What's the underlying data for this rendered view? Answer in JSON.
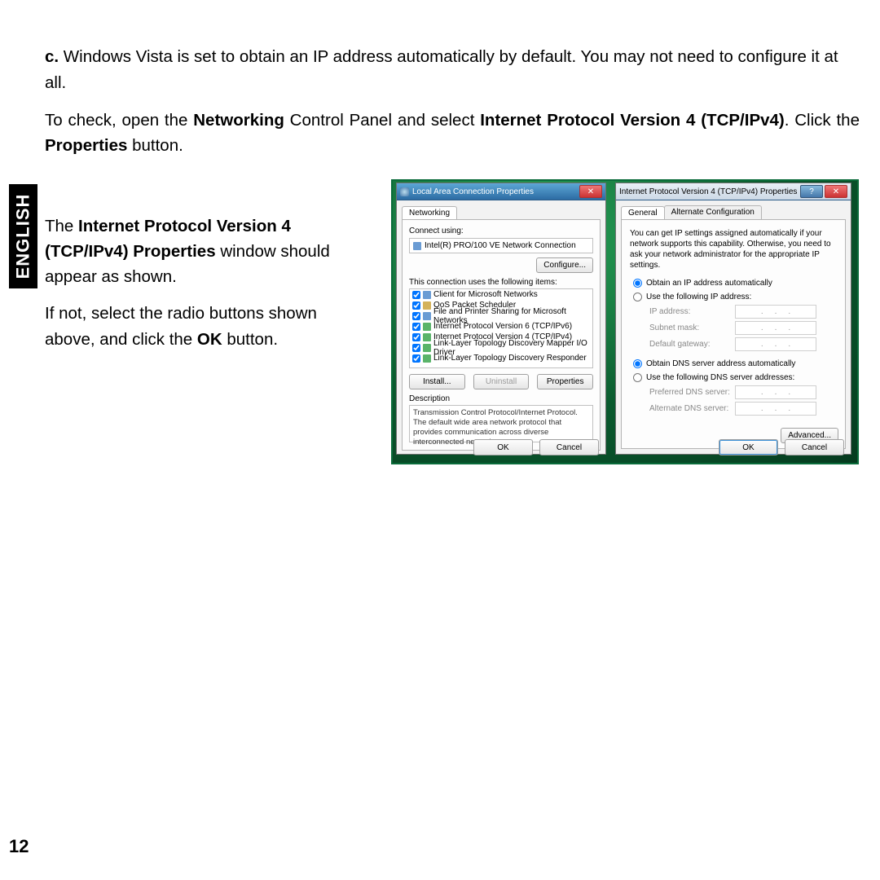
{
  "lang_label": "ENGLISH",
  "page_number": "12",
  "para": {
    "p1_a": "c.",
    "p1_b": " Windows Vista is set to obtain an IP address automatically by default. You may not need to configure it at all.",
    "p2_a": "To check, open the ",
    "p2_b": "Networking",
    "p2_c": " Control Panel and select ",
    "p2_d": "Internet Protocol Version 4 (TCP/IPv4)",
    "p2_e": ". Click the ",
    "p2_f": "Properties",
    "p2_g": " button.",
    "p3_a": "The ",
    "p3_b": "Internet Protocol Version 4 (TCP/IPv4) Properties",
    "p3_c": " window should appear as shown.",
    "p4_a": "If not, select the radio buttons shown above, and click the ",
    "p4_b": "OK",
    "p4_c": " button."
  },
  "dlg1": {
    "title": "Local Area Connection Properties",
    "tab": "Networking",
    "connect_using_label": "Connect using:",
    "adapter": "Intel(R) PRO/100 VE Network Connection",
    "configure_btn": "Configure...",
    "items_label": "This connection uses the following items:",
    "items": [
      "Client for Microsoft Networks",
      "QoS Packet Scheduler",
      "File and Printer Sharing for Microsoft Networks",
      "Internet Protocol Version 6 (TCP/IPv6)",
      "Internet Protocol Version 4 (TCP/IPv4)",
      "Link-Layer Topology Discovery Mapper I/O Driver",
      "Link-Layer Topology Discovery Responder"
    ],
    "install_btn": "Install...",
    "uninstall_btn": "Uninstall",
    "properties_btn": "Properties",
    "desc_label": "Description",
    "desc_text": "Transmission Control Protocol/Internet Protocol. The default wide area network protocol that provides communication across diverse interconnected networks.",
    "ok_btn": "OK",
    "cancel_btn": "Cancel"
  },
  "dlg2": {
    "title": "Internet Protocol Version 4 (TCP/IPv4) Properties",
    "tab1": "General",
    "tab2": "Alternate Configuration",
    "info": "You can get IP settings assigned automatically if your network supports this capability. Otherwise, you need to ask your network administrator for the appropriate IP settings.",
    "r1": "Obtain an IP address automatically",
    "r2": "Use the following IP address:",
    "ip_label": "IP address:",
    "mask_label": "Subnet mask:",
    "gw_label": "Default gateway:",
    "r3": "Obtain DNS server address automatically",
    "r4": "Use the following DNS server addresses:",
    "dns1_label": "Preferred DNS server:",
    "dns2_label": "Alternate DNS server:",
    "advanced_btn": "Advanced...",
    "ok_btn": "OK",
    "cancel_btn": "Cancel"
  }
}
